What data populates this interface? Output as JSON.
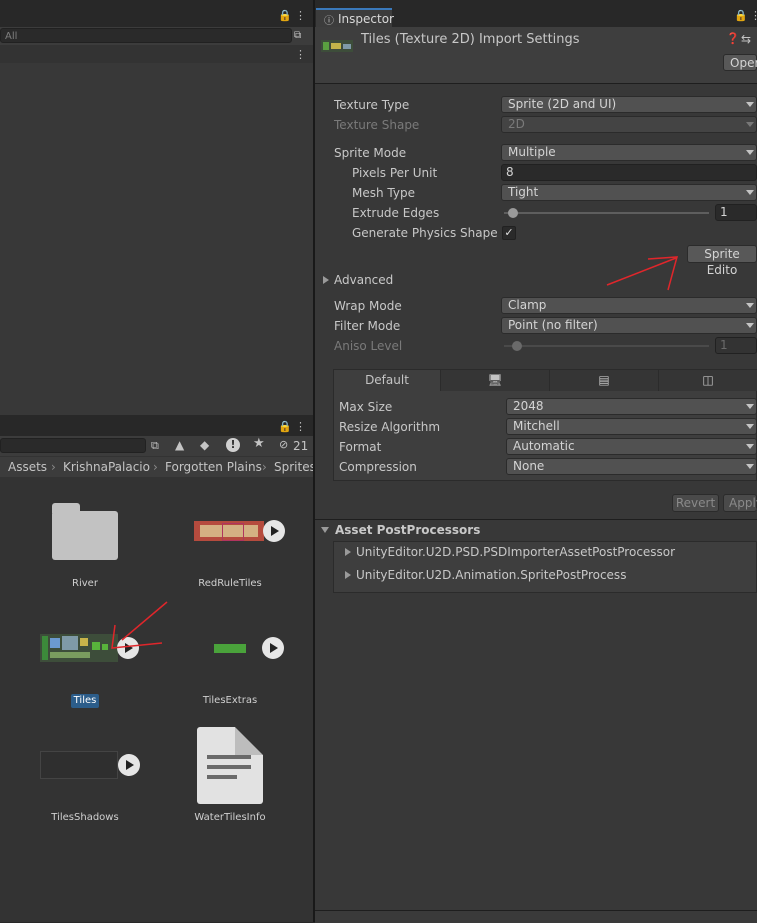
{
  "left_panel": {
    "search_placeholder": "All"
  },
  "project": {
    "visibility_count": "21",
    "breadcrumb": [
      "Assets",
      "KrishnaPalacio",
      "Forgotten Plains",
      "Sprites"
    ],
    "assets": [
      {
        "name": "River",
        "kind": "folder-icon"
      },
      {
        "name": "RedRuleTiles",
        "kind": "sprite-sheet"
      },
      {
        "name": "Tiles",
        "kind": "sprite-sheet",
        "selected": true
      },
      {
        "name": "TilesExtras",
        "kind": "sprite-sheet"
      },
      {
        "name": "TilesShadows",
        "kind": "sprite-sheet"
      },
      {
        "name": "WaterTilesInfo",
        "kind": "document-icon"
      }
    ]
  },
  "inspector": {
    "tab_label": "Inspector",
    "title": "Tiles (Texture 2D) Import Settings",
    "open_button": "Oper",
    "fields": {
      "texture_type": {
        "label": "Texture Type",
        "value": "Sprite (2D and UI)"
      },
      "texture_shape": {
        "label": "Texture Shape",
        "value": "2D"
      },
      "sprite_mode": {
        "label": "Sprite Mode",
        "value": "Multiple"
      },
      "pixels_per_unit": {
        "label": "Pixels Per Unit",
        "value": "8"
      },
      "mesh_type": {
        "label": "Mesh Type",
        "value": "Tight"
      },
      "extrude_edges": {
        "label": "Extrude Edges",
        "value": "1"
      },
      "generate_physics": {
        "label": "Generate Physics Shape",
        "checked": true
      },
      "sprite_editor_button": "Sprite Edito",
      "advanced": "Advanced",
      "wrap_mode": {
        "label": "Wrap Mode",
        "value": "Clamp"
      },
      "filter_mode": {
        "label": "Filter Mode",
        "value": "Point (no filter)"
      },
      "aniso_level": {
        "label": "Aniso Level",
        "value": "1"
      }
    },
    "platform_tabs": {
      "default_label": "Default",
      "icons": [
        "monitor-icon",
        "server-icon",
        "html5-icon"
      ]
    },
    "platform_fields": {
      "max_size": {
        "label": "Max Size",
        "value": "2048"
      },
      "resize_algorithm": {
        "label": "Resize Algorithm",
        "value": "Mitchell"
      },
      "format": {
        "label": "Format",
        "value": "Automatic"
      },
      "compression": {
        "label": "Compression",
        "value": "None"
      }
    },
    "revert_button": "Revert",
    "apply_button": "Apply",
    "asset_postprocessors": {
      "title": "Asset PostProcessors",
      "items": [
        "UnityEditor.U2D.PSD.PSDImporterAssetPostProcessor",
        "UnityEditor.U2D.Animation.SpritePostProcess"
      ]
    }
  },
  "annotation_color": "#e0262b"
}
